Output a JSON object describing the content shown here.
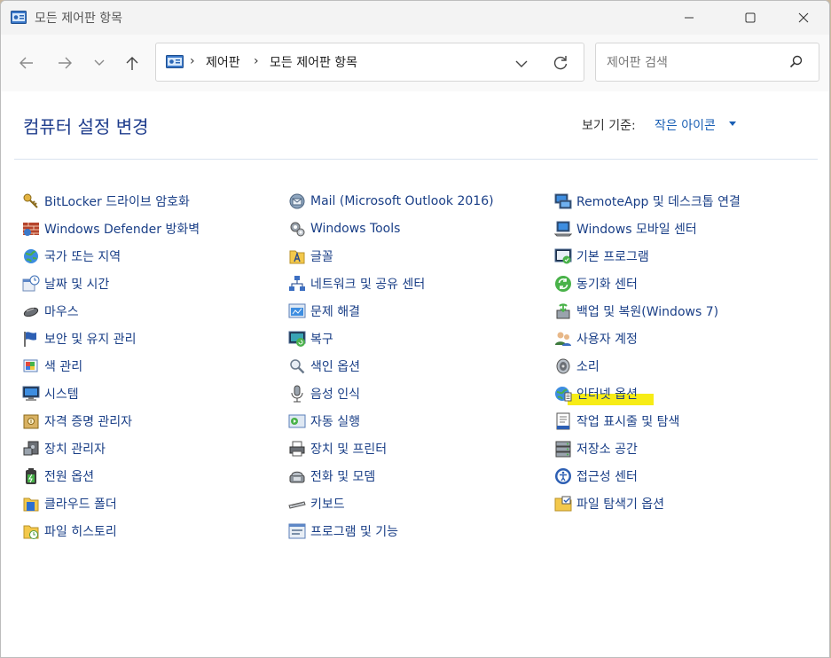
{
  "window": {
    "title": "모든 제어판 항목"
  },
  "address": {
    "crumbs": [
      "제어판",
      "모든 제어판 항목"
    ]
  },
  "search": {
    "placeholder": "제어판 검색"
  },
  "content": {
    "title": "컴퓨터 설정 변경",
    "view_by_label": "보기 기준:",
    "view_by_value": "작은 아이콘"
  },
  "colors": {
    "link": "#1a3f87",
    "title": "#1e3c8c",
    "accent": "#1a5fb4",
    "highlight": "#f7ec16"
  },
  "columns": [
    {
      "items": [
        {
          "label": "BitLocker 드라이브 암호화",
          "icon": "key-icon"
        },
        {
          "label": "Windows Defender 방화벽",
          "icon": "firewall-icon"
        },
        {
          "label": "국가 또는 지역",
          "icon": "globe-icon"
        },
        {
          "label": "날짜 및 시간",
          "icon": "clock-icon"
        },
        {
          "label": "마우스",
          "icon": "mouse-icon"
        },
        {
          "label": "보안 및 유지 관리",
          "icon": "flag-icon"
        },
        {
          "label": "색 관리",
          "icon": "color-icon"
        },
        {
          "label": "시스템",
          "icon": "monitor-icon"
        },
        {
          "label": "자격 증명 관리자",
          "icon": "vault-icon"
        },
        {
          "label": "장치 관리자",
          "icon": "device-manager-icon"
        },
        {
          "label": "전원 옵션",
          "icon": "battery-icon"
        },
        {
          "label": "클라우드 폴더",
          "icon": "cloud-folder-icon"
        },
        {
          "label": "파일 히스토리",
          "icon": "file-history-icon"
        }
      ]
    },
    {
      "items": [
        {
          "label": "Mail (Microsoft Outlook 2016)",
          "icon": "mail-icon"
        },
        {
          "label": "Windows Tools",
          "icon": "tools-icon"
        },
        {
          "label": "글꼴",
          "icon": "font-icon"
        },
        {
          "label": "네트워크 및 공유 센터",
          "icon": "network-icon"
        },
        {
          "label": "문제 해결",
          "icon": "troubleshoot-icon"
        },
        {
          "label": "복구",
          "icon": "recovery-icon"
        },
        {
          "label": "색인 옵션",
          "icon": "index-icon"
        },
        {
          "label": "음성 인식",
          "icon": "microphone-icon"
        },
        {
          "label": "자동 실행",
          "icon": "autoplay-icon"
        },
        {
          "label": "장치 및 프린터",
          "icon": "printer-icon"
        },
        {
          "label": "전화 및 모뎀",
          "icon": "phone-icon"
        },
        {
          "label": "키보드",
          "icon": "keyboard-icon"
        },
        {
          "label": "프로그램 및 기능",
          "icon": "programs-icon"
        }
      ]
    },
    {
      "items": [
        {
          "label": "RemoteApp 및 데스크톱 연결",
          "icon": "remote-icon"
        },
        {
          "label": "Windows 모바일 센터",
          "icon": "mobility-icon"
        },
        {
          "label": "기본 프로그램",
          "icon": "default-programs-icon"
        },
        {
          "label": "동기화 센터",
          "icon": "sync-icon"
        },
        {
          "label": "백업 및 복원(Windows 7)",
          "icon": "backup-icon"
        },
        {
          "label": "사용자 계정",
          "icon": "users-icon"
        },
        {
          "label": "소리",
          "icon": "speaker-icon"
        },
        {
          "label": "인터넷 옵션",
          "icon": "internet-icon"
        },
        {
          "label": "작업 표시줄 및 탐색",
          "icon": "taskbar-icon"
        },
        {
          "label": "저장소 공간",
          "icon": "storage-icon"
        },
        {
          "label": "접근성 센터",
          "icon": "accessibility-icon"
        },
        {
          "label": "파일 탐색기 옵션",
          "icon": "folder-options-icon"
        }
      ]
    }
  ]
}
